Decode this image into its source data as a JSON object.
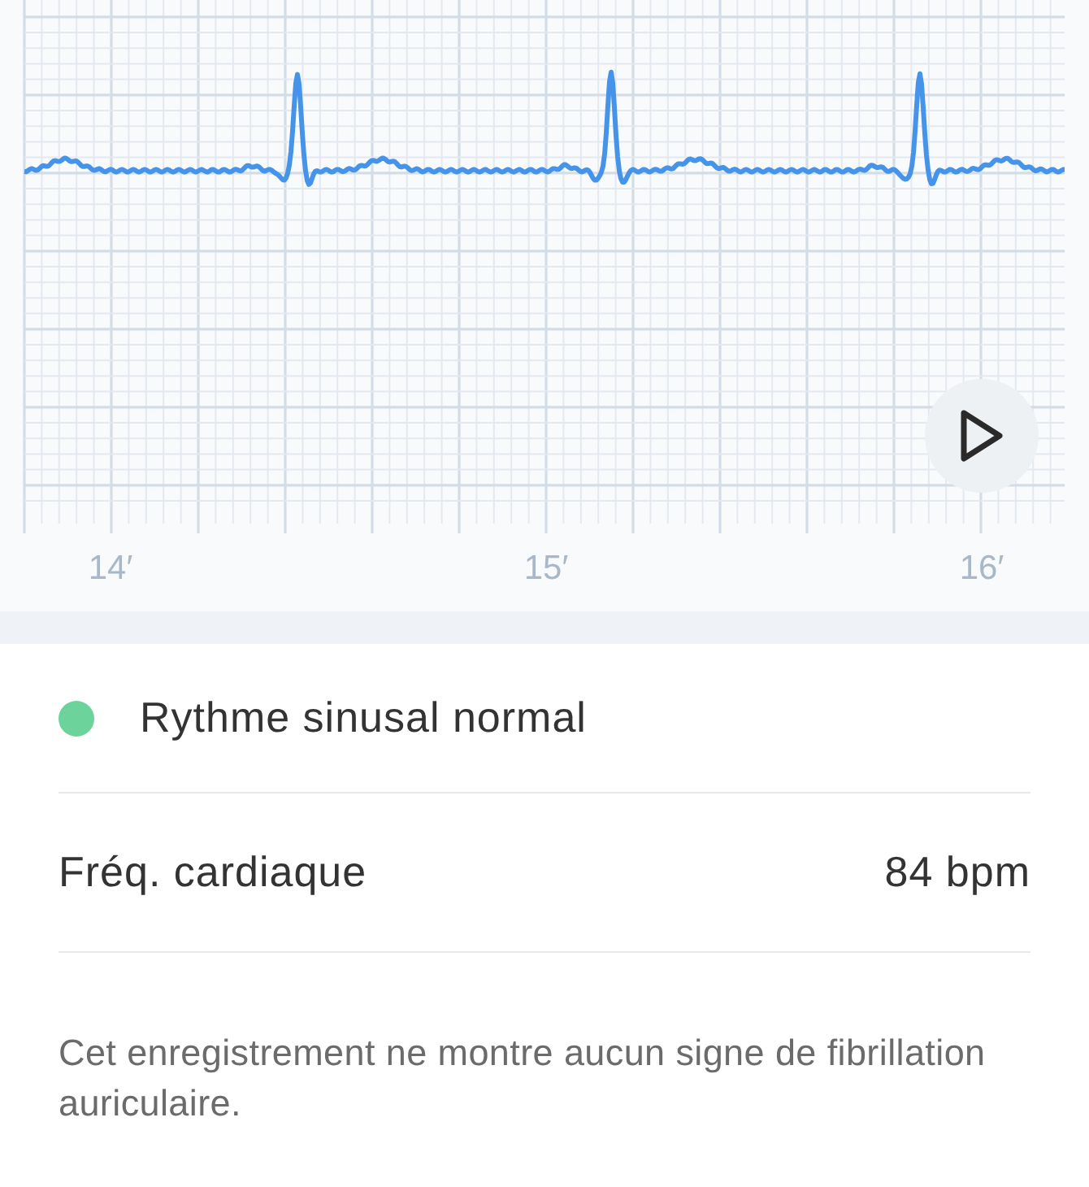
{
  "chart": {
    "x_labels": [
      "14′",
      "15′",
      "16′"
    ]
  },
  "rhythm": {
    "label": "Rythme sinusal normal"
  },
  "heart_rate": {
    "label": "Fréq. cardiaque",
    "value": "84 bpm"
  },
  "summary": "Cet enregistrement ne montre aucun signe de fibrillation auriculaire."
}
